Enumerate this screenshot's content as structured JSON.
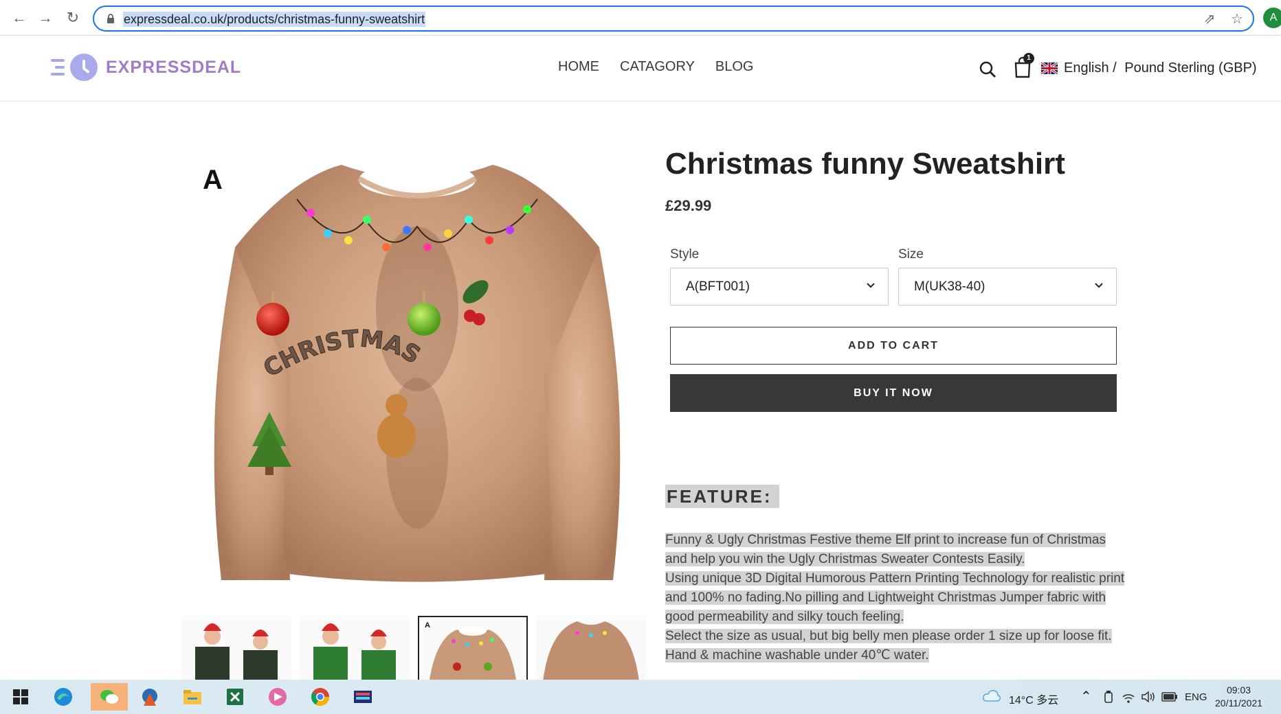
{
  "browser": {
    "url": "expressdeal.co.uk/products/christmas-funny-sweatshirt",
    "profile_initial": "A"
  },
  "site": {
    "logo_text": "EXPRESSDEAL",
    "nav": [
      "HOME",
      "CATAGORY",
      "BLOG"
    ],
    "cart_count": "1",
    "language": "English /",
    "currency": "Pound Sterling (GBP)"
  },
  "product": {
    "variant_letter": "A",
    "sweater_text": "CHRISTMAS",
    "title": "Christmas funny Sweatshirt",
    "price": "£29.99",
    "style_label": "Style",
    "style_value": "A(BFT001)",
    "size_label": "Size",
    "size_value": "M(UK38-40)",
    "add_to_cart": "ADD TO CART",
    "buy_now": "BUY IT NOW",
    "feature_heading": "FEATURE:",
    "description": [
      "Funny & Ugly Christmas Festive theme Elf print to increase fun of Christmas",
      "and help you win the Ugly Christmas Sweater Contests Easily.",
      "Using unique 3D Digital Humorous Pattern Printing Technology for realistic print",
      "and 100% no fading.No pilling and Lightweight Christmas Jumper fabric with",
      "good permeability and silky touch feeling.",
      "Select the size as usual, but big belly men please order 1 size up for loose fit.",
      "Hand & machine washable under 40℃ water."
    ],
    "thumbnail_active_letter": "A"
  },
  "taskbar": {
    "weather": "14°C 多云",
    "lang": "ENG",
    "time": "09:03",
    "date": "20/11/2021"
  }
}
